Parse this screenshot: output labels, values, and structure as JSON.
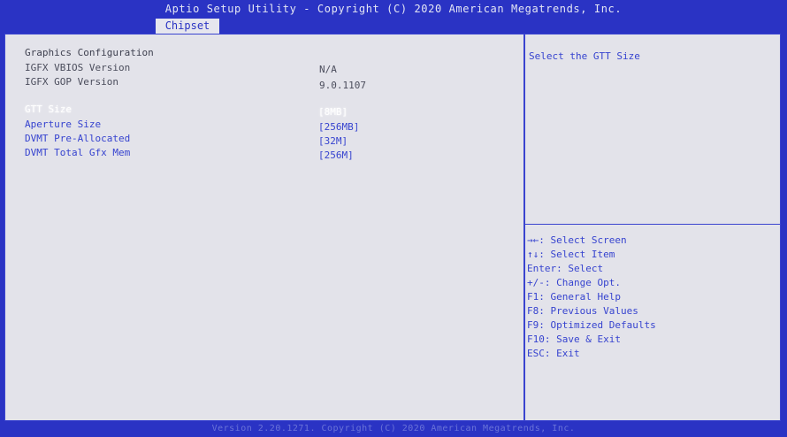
{
  "header": {
    "title": "Aptio Setup Utility - Copyright (C) 2020 American Megatrends, Inc.",
    "tab": "Chipset"
  },
  "main": {
    "section_title": "Graphics Configuration",
    "info": [
      {
        "label": "IGFX VBIOS Version",
        "value": "N/A"
      },
      {
        "label": "IGFX GOP Version",
        "value": "9.0.1107"
      }
    ],
    "options": [
      {
        "label": "GTT Size",
        "value": "[8MB]",
        "selected": true
      },
      {
        "label": "Aperture Size",
        "value": "[256MB]"
      },
      {
        "label": "DVMT Pre-Allocated",
        "value": "[32M]"
      },
      {
        "label": "DVMT Total Gfx Mem",
        "value": "[256M]"
      }
    ]
  },
  "help": {
    "text": "Select the GTT Size"
  },
  "keys": [
    "→←: Select Screen",
    "↑↓: Select Item",
    "Enter: Select",
    "+/-: Change Opt.",
    "F1: General Help",
    "F8: Previous Values",
    "F9: Optimized Defaults",
    "F10: Save & Exit",
    "ESC: Exit"
  ],
  "footer": {
    "text": "Version 2.20.1271. Copyright (C) 2020 American Megatrends, Inc."
  },
  "colors": {
    "background": "#2a33c4",
    "panel": "#e3e3ea",
    "accent": "#3643cf"
  }
}
